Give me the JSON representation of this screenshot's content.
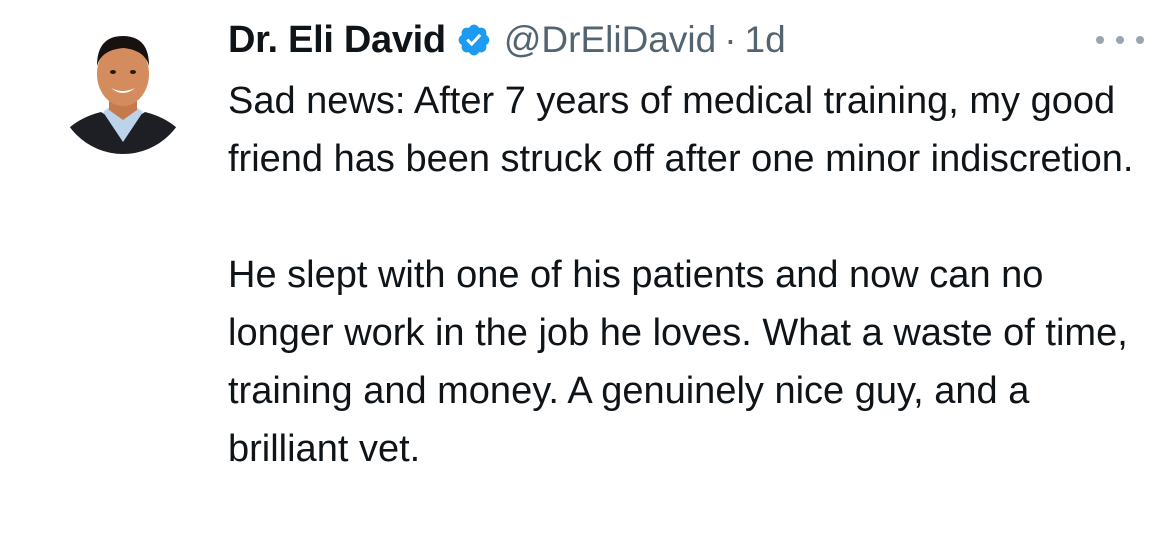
{
  "author": {
    "display_name": "Dr. Eli David",
    "handle": "@DrEliDavid",
    "separator": "·",
    "timestamp": "1d",
    "verified_icon": "verified-badge-icon",
    "avatar_icon": "profile-photo"
  },
  "more_menu": {
    "icon": "more-horizontal-icon"
  },
  "tweet": {
    "paragraph1": "Sad news: After 7 years of medical training, my good friend has been struck off after one minor indiscretion.",
    "paragraph2": "He slept with one of his patients and now can no longer work in the job he loves. What a waste of time, training and money. A genuinely nice guy, and a brilliant vet."
  },
  "colors": {
    "text": "#0f1419",
    "secondary": "#536471",
    "verified": "#1d9bf0",
    "background": "#ffffff"
  }
}
